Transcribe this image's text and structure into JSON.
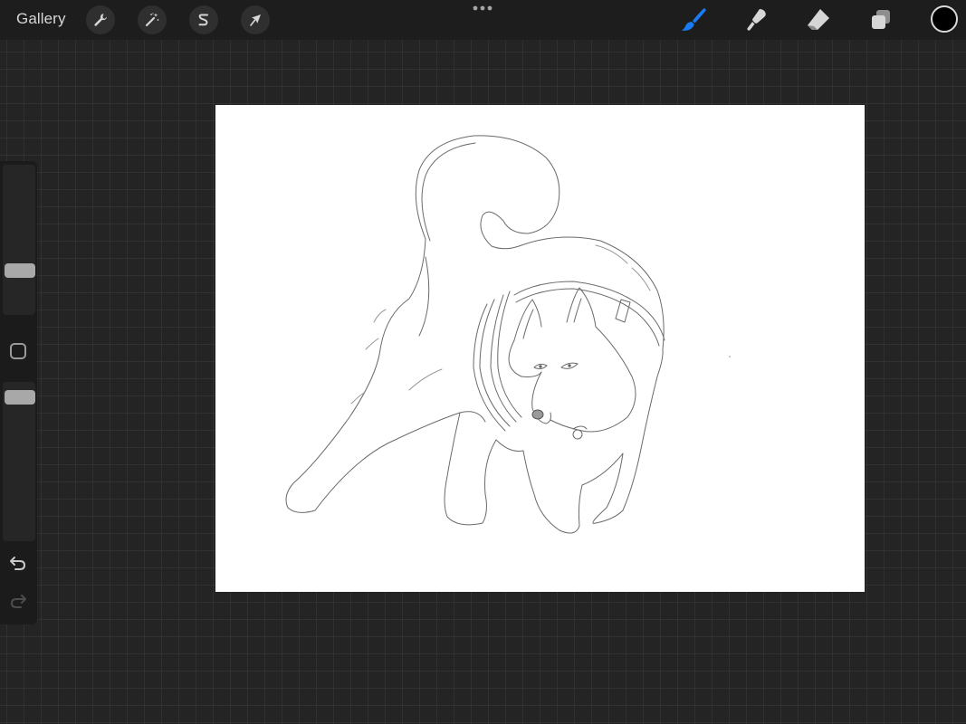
{
  "toolbar": {
    "gallery_label": "Gallery",
    "left_tools": [
      {
        "name": "actions",
        "icon": "wrench-icon"
      },
      {
        "name": "adjustments",
        "icon": "magic-wand-icon"
      },
      {
        "name": "selection",
        "icon": "selection-s-icon"
      },
      {
        "name": "transform",
        "icon": "arrow-cursor-icon"
      }
    ],
    "more_icon": "more-dots-icon",
    "right_tools": [
      {
        "name": "brush",
        "icon": "brush-icon",
        "active": true
      },
      {
        "name": "smudge",
        "icon": "smudge-icon",
        "active": false
      },
      {
        "name": "eraser",
        "icon": "eraser-icon",
        "active": false
      },
      {
        "name": "layers",
        "icon": "layers-icon",
        "active": false
      }
    ],
    "current_color": "#000000",
    "active_color": "#1a7cf5"
  },
  "sidebar": {
    "brush_size_icon": "slider-thumb",
    "modify_icon": "modify-square-icon",
    "opacity_icon": "slider-thumb",
    "undo_icon": "undo-arrow-icon",
    "redo_icon": "redo-arrow-icon",
    "redo_enabled": false
  },
  "canvas": {
    "background": "#ffffff",
    "content": "pencil-sketch-husky-in-harness"
  }
}
